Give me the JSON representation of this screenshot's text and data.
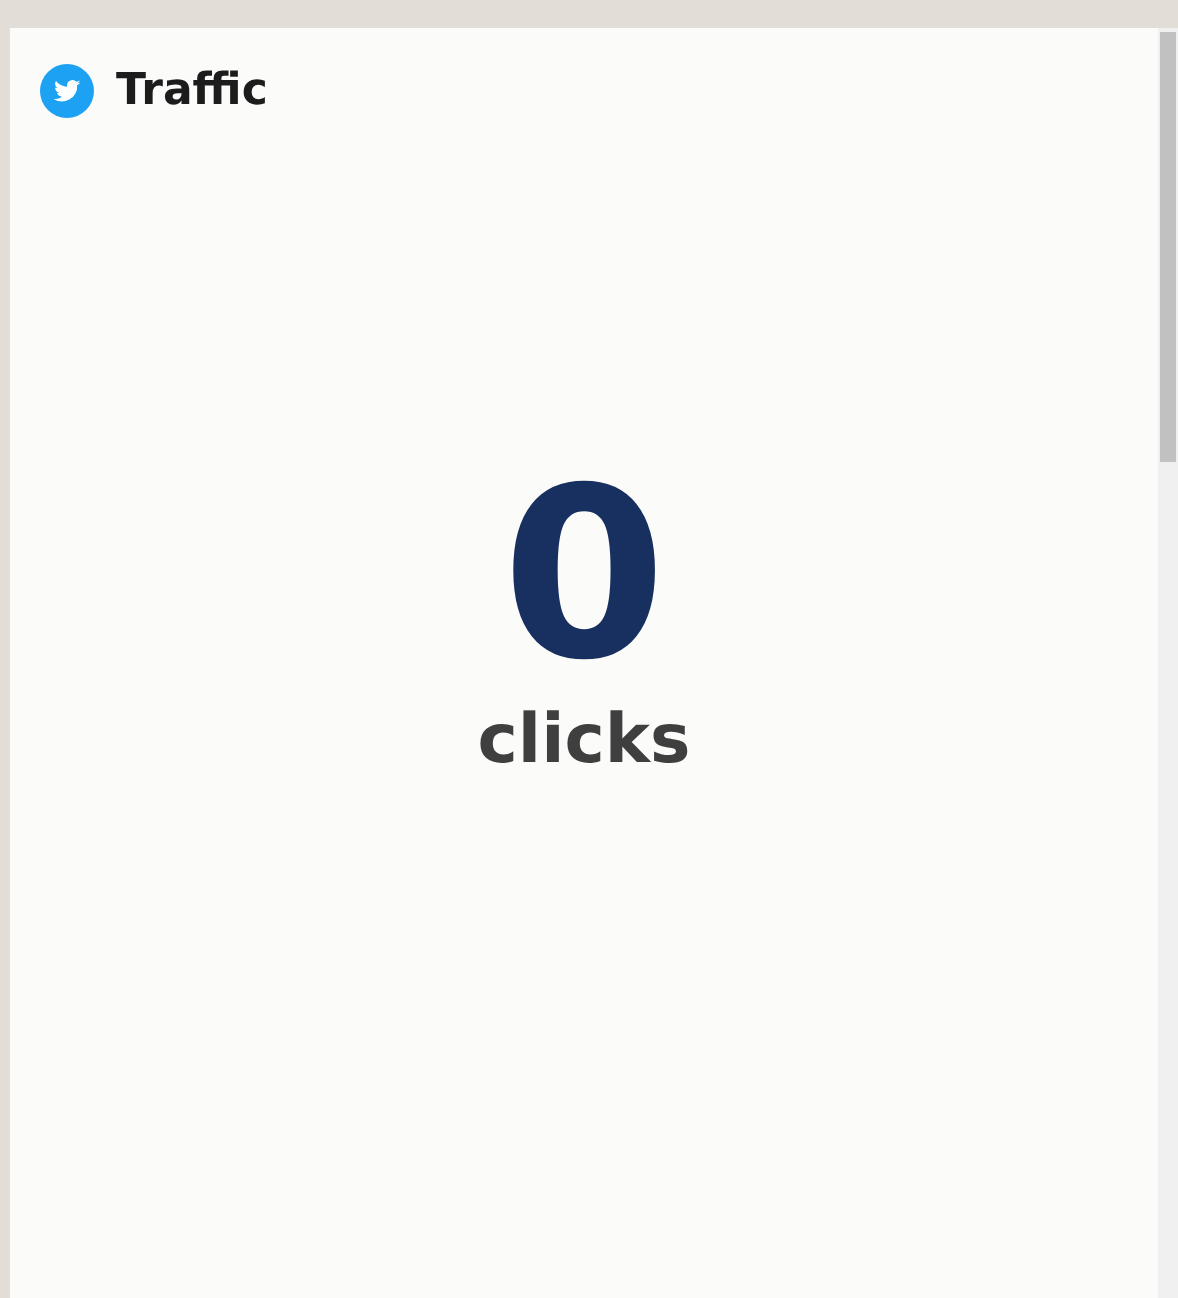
{
  "widget": {
    "title": "Traffic",
    "value": "0",
    "unit": "clicks"
  }
}
